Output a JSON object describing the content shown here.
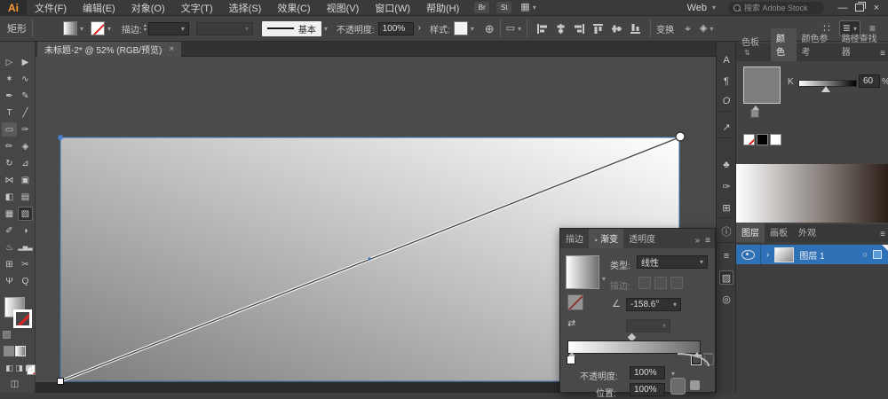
{
  "app": {
    "logo": "Ai"
  },
  "menu_bar": {
    "menus": [
      "文件(F)",
      "编辑(E)",
      "对象(O)",
      "文字(T)",
      "选择(S)",
      "效果(C)",
      "视图(V)",
      "窗口(W)",
      "帮助(H)"
    ],
    "badge_br": "Br",
    "badge_st": "St",
    "workspace": "Web",
    "search_placeholder": "搜索 Adobe Stock",
    "minimize": "—",
    "close": "×"
  },
  "control_bar": {
    "tool_label": "矩形",
    "stroke_label": "描边:",
    "stroke_style": "基本",
    "opacity_label": "不透明度:",
    "opacity_value": "100%",
    "more_glyph": "›",
    "style_label": "样式:",
    "transform_label": "变换"
  },
  "doc_tab": {
    "title": "未标题-2* @ 52% (RGB/预览)",
    "close": "×"
  },
  "tools": [
    {
      "name": "selection-tool",
      "glyph": "▷"
    },
    {
      "name": "direct-selection-tool",
      "glyph": "▶"
    },
    {
      "name": "magic-wand-tool",
      "glyph": "✶"
    },
    {
      "name": "lasso-tool",
      "glyph": "∿"
    },
    {
      "name": "pen-tool",
      "glyph": "✒"
    },
    {
      "name": "curvature-tool",
      "glyph": "✎"
    },
    {
      "name": "type-tool",
      "glyph": "T"
    },
    {
      "name": "line-segment-tool",
      "glyph": "╱"
    },
    {
      "name": "rectangle-tool",
      "glyph": "▭"
    },
    {
      "name": "paintbrush-tool",
      "glyph": "✑"
    },
    {
      "name": "pencil-tool",
      "glyph": "✏"
    },
    {
      "name": "shaper-tool",
      "glyph": "◈"
    },
    {
      "name": "rotate-tool",
      "glyph": "↻"
    },
    {
      "name": "scale-tool",
      "glyph": "⊿"
    },
    {
      "name": "width-tool",
      "glyph": "⋈"
    },
    {
      "name": "free-transform-tool",
      "glyph": "▣"
    },
    {
      "name": "shape-builder-tool",
      "glyph": "◧"
    },
    {
      "name": "perspective-grid-tool",
      "glyph": "▤"
    },
    {
      "name": "mesh-tool",
      "glyph": "▦"
    },
    {
      "name": "gradient-tool",
      "glyph": "▨"
    },
    {
      "name": "eyedropper-tool",
      "glyph": "✐"
    },
    {
      "name": "blend-tool",
      "glyph": "◑"
    },
    {
      "name": "symbol-sprayer-tool",
      "glyph": "♨"
    },
    {
      "name": "graph-tool",
      "glyph": "▂▅▃"
    },
    {
      "name": "artboard-tool",
      "glyph": "⊞"
    },
    {
      "name": "slice-tool",
      "glyph": "✂"
    },
    {
      "name": "hand-tool",
      "glyph": "Ψ"
    },
    {
      "name": "zoom-tool",
      "glyph": "Q"
    }
  ],
  "canvas": {
    "fill_start": "#7c7c7c",
    "fill_end": "#ffffff",
    "selection_color": "#3f6fb5"
  },
  "gradient_panel": {
    "tab_stroke": "描边",
    "tab_gradient": "渐变",
    "tab_transparency": "透明度",
    "overflow": "»",
    "menu_glyph": "≡",
    "type_label": "类型:",
    "type_value": "线性",
    "stroke_label": "描边:",
    "angle_glyph": "∠",
    "angle_value": "-158.6°",
    "opacity_label": "不透明度:",
    "opacity_value": "100%",
    "position_label": "位置:",
    "position_value": "100%"
  },
  "dock": [
    {
      "name": "character-panel-icon",
      "glyph": "A"
    },
    {
      "name": "paragraph-panel-icon",
      "glyph": "¶"
    },
    {
      "name": "opentype-panel-icon",
      "glyph": "O"
    },
    {
      "name": "export-panel-icon",
      "glyph": "↗"
    },
    {
      "name": "symbols-panel-icon",
      "glyph": "♣"
    },
    {
      "name": "brushes-panel-icon",
      "glyph": "✑"
    },
    {
      "name": "libraries-panel-icon",
      "glyph": "⊞"
    },
    {
      "name": "info-panel-icon",
      "glyph": "ⓘ"
    },
    {
      "name": "stroke-panel-icon",
      "glyph": "≡"
    },
    {
      "name": "gradient-panel-icon",
      "glyph": "▨"
    },
    {
      "name": "transparency-panel-icon",
      "glyph": "◎"
    }
  ],
  "color_panel": {
    "tab_swatches": "色板",
    "tab_color": "颜色",
    "tab_guide": "颜色参考",
    "tab_pathfinder": "路径查找器",
    "menu_glyph": "≡",
    "sort_glyph": "⇅",
    "channel": "K",
    "value": "60",
    "percent": "%"
  },
  "layers_panel": {
    "tab_layers": "图层",
    "tab_artboards": "画板",
    "tab_appearance": "外观",
    "menu_glyph": "≡",
    "expand_glyph": "›",
    "layer_name": "图层 1",
    "target_glyph": "○"
  }
}
